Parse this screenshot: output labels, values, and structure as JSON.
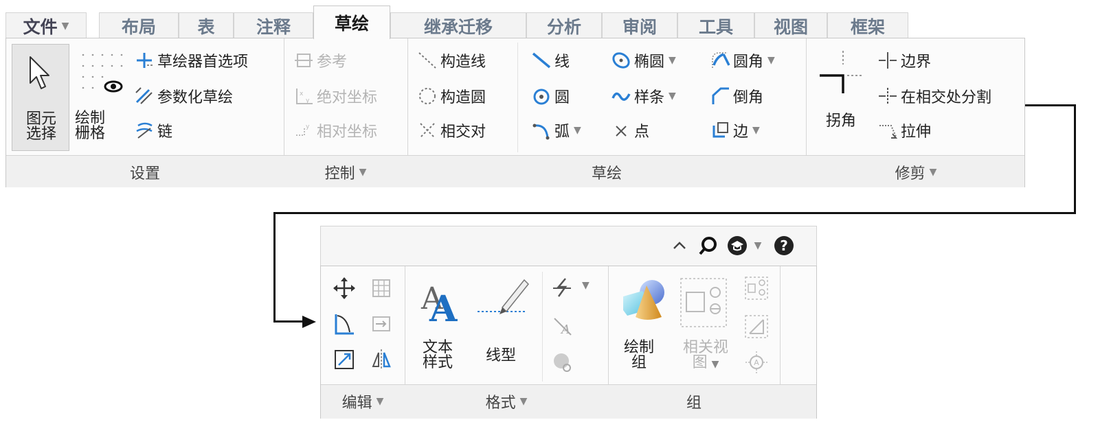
{
  "tabs": [
    {
      "label": "文件",
      "has_dropdown": true
    },
    {
      "label": "布局"
    },
    {
      "label": "表"
    },
    {
      "label": "注释"
    },
    {
      "label": "草绘",
      "active": true
    },
    {
      "label": "继承迁移"
    },
    {
      "label": "分析"
    },
    {
      "label": "审阅"
    },
    {
      "label": "工具"
    },
    {
      "label": "视图"
    },
    {
      "label": "框架"
    }
  ],
  "settings": {
    "select_label_line1": "图元",
    "select_label_line2": "选择",
    "grid_label_line1": "绘制",
    "grid_label_line2": "栅格",
    "prefs": "草绘器首选项",
    "parametric": "参数化草绘",
    "chain": "链",
    "group_label": "设置"
  },
  "control": {
    "reference": "参考",
    "absolute": "绝对坐标",
    "relative": "相对坐标",
    "group_label": "控制"
  },
  "sketch": {
    "construction_line": "构造线",
    "construction_circle": "构造圆",
    "relative_pair": "相交对",
    "line": "线",
    "circle": "圆",
    "arc": "弧",
    "ellipse": "椭圆",
    "spline": "样条",
    "point": "点",
    "fillet": "圆角",
    "chamfer": "倒角",
    "edge": "边",
    "group_label": "草绘"
  },
  "trim": {
    "corner": "拐角",
    "boundary": "边界",
    "split": "在相交处分割",
    "stretch": "拉伸",
    "group_label": "修剪"
  },
  "panel2": {
    "edit_group": "编辑",
    "text_style_line1": "文本",
    "text_style_line2": "样式",
    "line_style": "线型",
    "format_group": "格式",
    "draw_group_line1": "绘制",
    "draw_group_line2": "组",
    "related_view_line1": "相关视",
    "related_view_line2": "图",
    "group_group": "组"
  },
  "colors": {
    "accent_blue": "#2a7fd4",
    "disabled": "#b4b4b4",
    "tab_inactive": "#6b7a8c"
  }
}
